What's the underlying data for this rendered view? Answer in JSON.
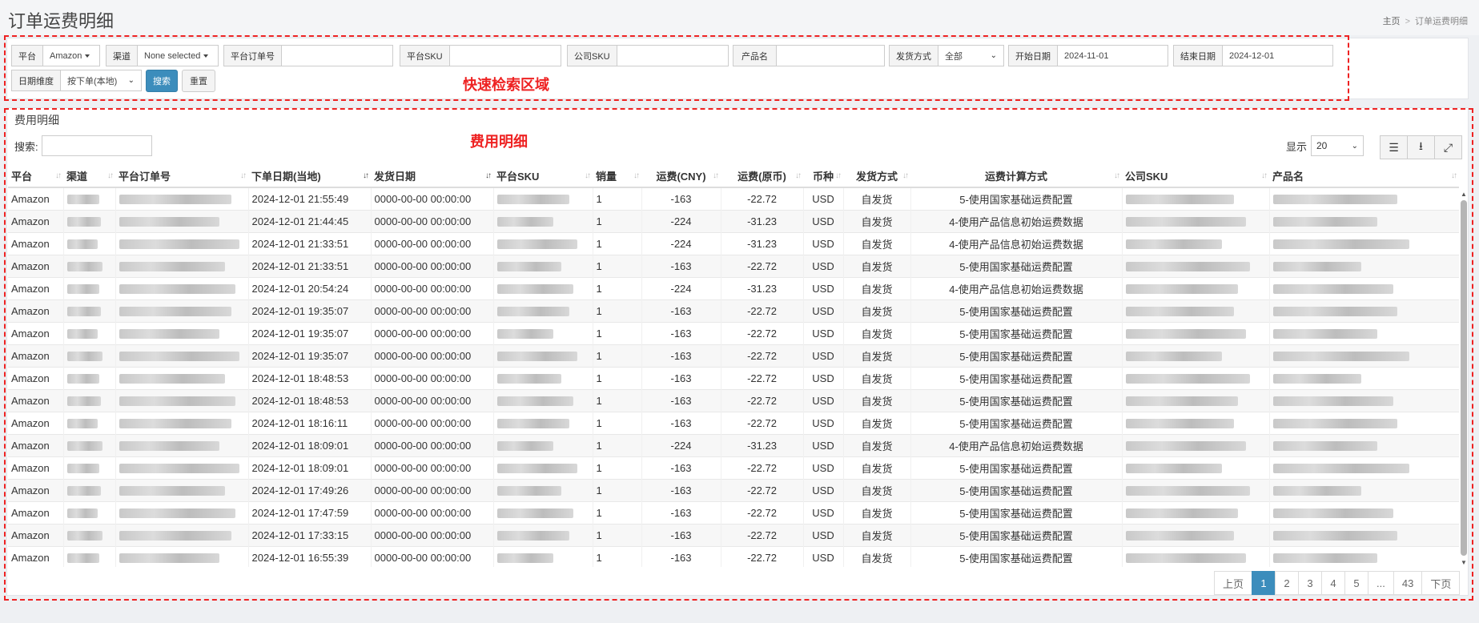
{
  "page": {
    "title": "订单运费明细",
    "breadcrumb": [
      "主页",
      "订单运费明细"
    ]
  },
  "filters": {
    "area_label": "快速检索区域",
    "platform": {
      "label": "平台",
      "value": "Amazon"
    },
    "channel": {
      "label": "渠道",
      "value": "None selected"
    },
    "platform_order_no": {
      "label": "平台订单号",
      "value": ""
    },
    "platform_sku": {
      "label": "平台SKU",
      "value": ""
    },
    "company_sku": {
      "label": "公司SKU",
      "value": ""
    },
    "product_name": {
      "label": "产品名",
      "value": ""
    },
    "shipping_method": {
      "label": "发货方式",
      "value": "全部"
    },
    "start_date": {
      "label": "开始日期",
      "value": "2024-11-01"
    },
    "end_date": {
      "label": "结束日期",
      "value": "2024-12-01"
    },
    "date_dimension": {
      "label": "日期维度",
      "value": "按下单(本地)"
    },
    "search_button": "搜索",
    "reset_button": "重置"
  },
  "detail": {
    "title": "费用明细",
    "area_label": "费用明细",
    "search_label": "搜索:",
    "search_value": "",
    "show_label": "显示",
    "page_size": "20",
    "tools": [
      "list-icon",
      "download-icon",
      "fullscreen-icon"
    ]
  },
  "table": {
    "columns": [
      "平台",
      "渠道",
      "平台订单号",
      "下单日期(当地)",
      "发货日期",
      "平台SKU",
      "销量",
      "运费(CNY)",
      "运费(原币)",
      "币种",
      "发货方式",
      "运费计算方式",
      "公司SKU",
      "产品名"
    ],
    "rows": [
      [
        "Amazon",
        "",
        "",
        "2024-12-01 21:55:49",
        "0000-00-00 00:00:00",
        "",
        "1",
        "-163",
        "-22.72",
        "USD",
        "自发货",
        "5-使用国家基础运费配置",
        "",
        ""
      ],
      [
        "Amazon",
        "",
        "",
        "2024-12-01 21:44:45",
        "0000-00-00 00:00:00",
        "",
        "1",
        "-224",
        "-31.23",
        "USD",
        "自发货",
        "4-使用产品信息初始运费数据",
        "",
        ""
      ],
      [
        "Amazon",
        "",
        "",
        "2024-12-01 21:33:51",
        "0000-00-00 00:00:00",
        "",
        "1",
        "-224",
        "-31.23",
        "USD",
        "自发货",
        "4-使用产品信息初始运费数据",
        "",
        ""
      ],
      [
        "Amazon",
        "",
        "",
        "2024-12-01 21:33:51",
        "0000-00-00 00:00:00",
        "",
        "1",
        "-163",
        "-22.72",
        "USD",
        "自发货",
        "5-使用国家基础运费配置",
        "",
        ""
      ],
      [
        "Amazon",
        "",
        "",
        "2024-12-01 20:54:24",
        "0000-00-00 00:00:00",
        "",
        "1",
        "-224",
        "-31.23",
        "USD",
        "自发货",
        "4-使用产品信息初始运费数据",
        "",
        ""
      ],
      [
        "Amazon",
        "",
        "",
        "2024-12-01 19:35:07",
        "0000-00-00 00:00:00",
        "",
        "1",
        "-163",
        "-22.72",
        "USD",
        "自发货",
        "5-使用国家基础运费配置",
        "",
        ""
      ],
      [
        "Amazon",
        "",
        "",
        "2024-12-01 19:35:07",
        "0000-00-00 00:00:00",
        "",
        "1",
        "-163",
        "-22.72",
        "USD",
        "自发货",
        "5-使用国家基础运费配置",
        "",
        ""
      ],
      [
        "Amazon",
        "",
        "",
        "2024-12-01 19:35:07",
        "0000-00-00 00:00:00",
        "",
        "1",
        "-163",
        "-22.72",
        "USD",
        "自发货",
        "5-使用国家基础运费配置",
        "",
        ""
      ],
      [
        "Amazon",
        "",
        "",
        "2024-12-01 18:48:53",
        "0000-00-00 00:00:00",
        "",
        "1",
        "-163",
        "-22.72",
        "USD",
        "自发货",
        "5-使用国家基础运费配置",
        "",
        ""
      ],
      [
        "Amazon",
        "",
        "",
        "2024-12-01 18:48:53",
        "0000-00-00 00:00:00",
        "",
        "1",
        "-163",
        "-22.72",
        "USD",
        "自发货",
        "5-使用国家基础运费配置",
        "",
        ""
      ],
      [
        "Amazon",
        "",
        "",
        "2024-12-01 18:16:11",
        "0000-00-00 00:00:00",
        "",
        "1",
        "-163",
        "-22.72",
        "USD",
        "自发货",
        "5-使用国家基础运费配置",
        "",
        ""
      ],
      [
        "Amazon",
        "",
        "",
        "2024-12-01 18:09:01",
        "0000-00-00 00:00:00",
        "",
        "1",
        "-224",
        "-31.23",
        "USD",
        "自发货",
        "4-使用产品信息初始运费数据",
        "",
        ""
      ],
      [
        "Amazon",
        "",
        "",
        "2024-12-01 18:09:01",
        "0000-00-00 00:00:00",
        "",
        "1",
        "-163",
        "-22.72",
        "USD",
        "自发货",
        "5-使用国家基础运费配置",
        "",
        ""
      ],
      [
        "Amazon",
        "",
        "",
        "2024-12-01 17:49:26",
        "0000-00-00 00:00:00",
        "",
        "1",
        "-163",
        "-22.72",
        "USD",
        "自发货",
        "5-使用国家基础运费配置",
        "",
        ""
      ],
      [
        "Amazon",
        "",
        "",
        "2024-12-01 17:47:59",
        "0000-00-00 00:00:00",
        "",
        "1",
        "-163",
        "-22.72",
        "USD",
        "自发货",
        "5-使用国家基础运费配置",
        "",
        ""
      ],
      [
        "Amazon",
        "",
        "",
        "2024-12-01 17:33:15",
        "0000-00-00 00:00:00",
        "",
        "1",
        "-163",
        "-22.72",
        "USD",
        "自发货",
        "5-使用国家基础运费配置",
        "",
        ""
      ],
      [
        "Amazon",
        "",
        "",
        "2024-12-01 16:55:39",
        "0000-00-00 00:00:00",
        "",
        "1",
        "-163",
        "-22.72",
        "USD",
        "自发货",
        "5-使用国家基础运费配置",
        "",
        ""
      ]
    ]
  },
  "pagination": {
    "prev": "上页",
    "pages": [
      "1",
      "2",
      "3",
      "4",
      "5",
      "...",
      "43"
    ],
    "active": "1",
    "next": "下页"
  }
}
